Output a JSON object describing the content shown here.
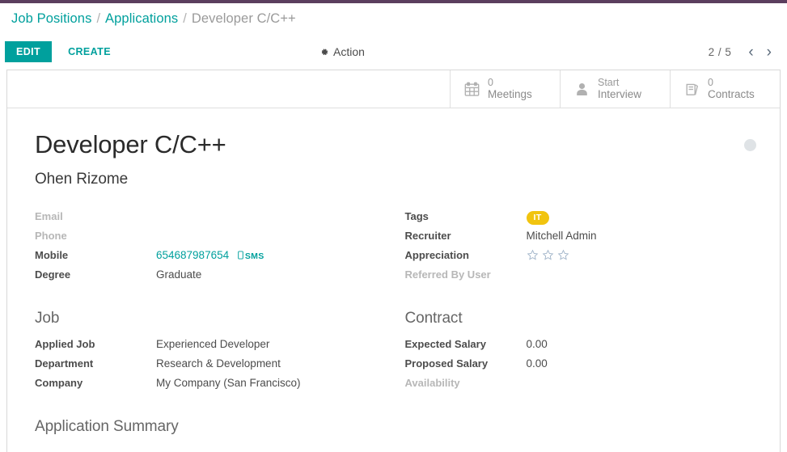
{
  "breadcrumb": {
    "items": [
      {
        "label": "Job Positions",
        "active": false
      },
      {
        "label": "Applications",
        "active": false
      },
      {
        "label": "Developer C/C++",
        "active": true
      }
    ],
    "separator": "/"
  },
  "control_panel": {
    "edit_label": "EDIT",
    "create_label": "CREATE",
    "action_label": "Action",
    "action_icon": "gear-icon",
    "pager": {
      "text": "2 / 5",
      "current": 2,
      "total": 5,
      "prev_icon": "chevron-left-icon",
      "next_icon": "chevron-right-icon"
    }
  },
  "stat_buttons": [
    {
      "value": "0",
      "label": "Meetings",
      "icon": "calendar-icon"
    },
    {
      "value": "Start",
      "label": "Interview",
      "icon": "person-icon"
    },
    {
      "value": "0",
      "label": "Contracts",
      "icon": "book-icon"
    }
  ],
  "record": {
    "title": "Developer C/C++",
    "subtitle": "Ohen Rizome",
    "priority_indicator": "kanban-state-dot"
  },
  "left_fields": [
    {
      "label": "Email",
      "value": "",
      "type": "empty"
    },
    {
      "label": "Phone",
      "value": "",
      "type": "empty"
    },
    {
      "label": "Mobile",
      "value": "654687987654",
      "type": "link",
      "extra": "SMS",
      "extra_icon": "mobile-icon"
    },
    {
      "label": "Degree",
      "value": "Graduate",
      "type": "link"
    }
  ],
  "right_fields": [
    {
      "label": "Tags",
      "value": "IT",
      "type": "tag"
    },
    {
      "label": "Recruiter",
      "value": "Mitchell Admin",
      "type": "link"
    },
    {
      "label": "Appreciation",
      "value": "",
      "type": "stars",
      "stars_total": 3,
      "stars_filled": 0
    },
    {
      "label": "Referred By User",
      "value": "",
      "type": "empty"
    }
  ],
  "job_group": {
    "title": "Job",
    "fields": [
      {
        "label": "Applied Job",
        "value": "Experienced Developer",
        "type": "link"
      },
      {
        "label": "Department",
        "value": "Research & Development",
        "type": "link"
      },
      {
        "label": "Company",
        "value": "My Company (San Francisco)",
        "type": "plain"
      }
    ]
  },
  "contract_group": {
    "title": "Contract",
    "fields": [
      {
        "label": "Expected Salary",
        "value": "0.00",
        "type": "plain"
      },
      {
        "label": "Proposed Salary",
        "value": "0.00",
        "type": "plain"
      },
      {
        "label": "Availability",
        "value": "",
        "type": "empty"
      }
    ]
  },
  "summary_section": {
    "title": "Application Summary"
  },
  "colors": {
    "accent": "#00A09D",
    "top_strip": "#5B3E5E",
    "tag": "#F1C40F",
    "label": "#4c4c4c",
    "muted": "#b7b7b7"
  }
}
